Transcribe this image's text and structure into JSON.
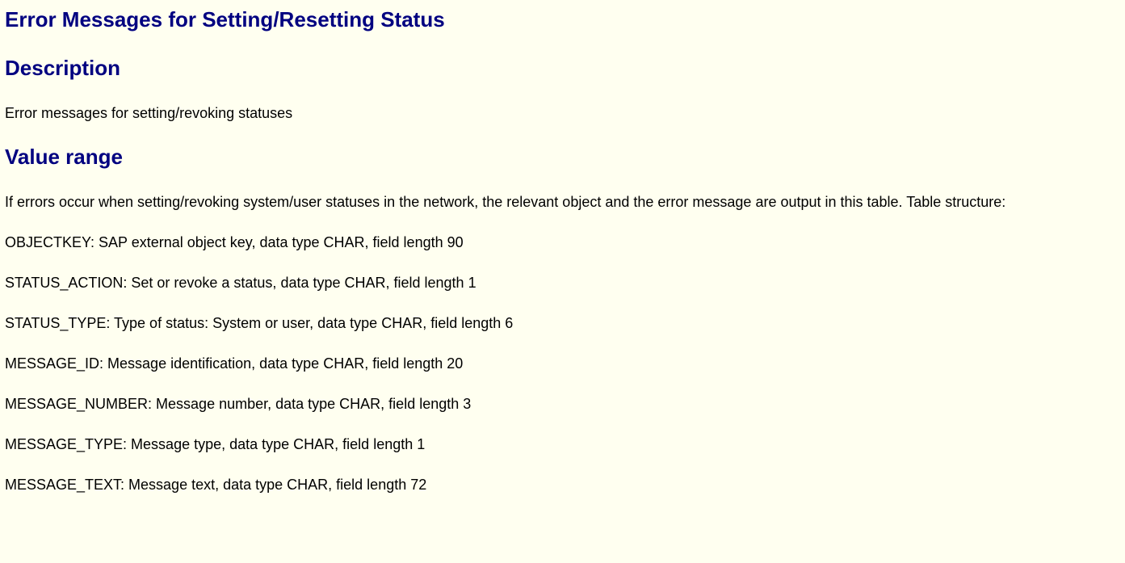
{
  "title": "Error Messages for Setting/Resetting Status",
  "sections": {
    "description": {
      "heading": "Description",
      "text": "Error messages for setting/revoking statuses"
    },
    "value_range": {
      "heading": "Value range",
      "intro": "If errors occur when setting/revoking system/user statuses in the network, the relevant object and the error message are output in this table. Table structure:",
      "fields": [
        "OBJECTKEY: SAP external object key, data type CHAR, field length 90",
        "STATUS_ACTION: Set or revoke a status, data type CHAR, field length 1",
        "STATUS_TYPE: Type of status: System or user, data type CHAR, field length 6",
        "MESSAGE_ID: Message identification, data type CHAR, field length 20",
        "MESSAGE_NUMBER: Message number, data type CHAR, field length 3",
        "MESSAGE_TYPE: Message type, data type CHAR, field length 1",
        "MESSAGE_TEXT: Message text, data type CHAR, field length 72"
      ]
    }
  },
  "colors": {
    "background": "#fffff0",
    "heading": "#000080",
    "text": "#000000"
  }
}
